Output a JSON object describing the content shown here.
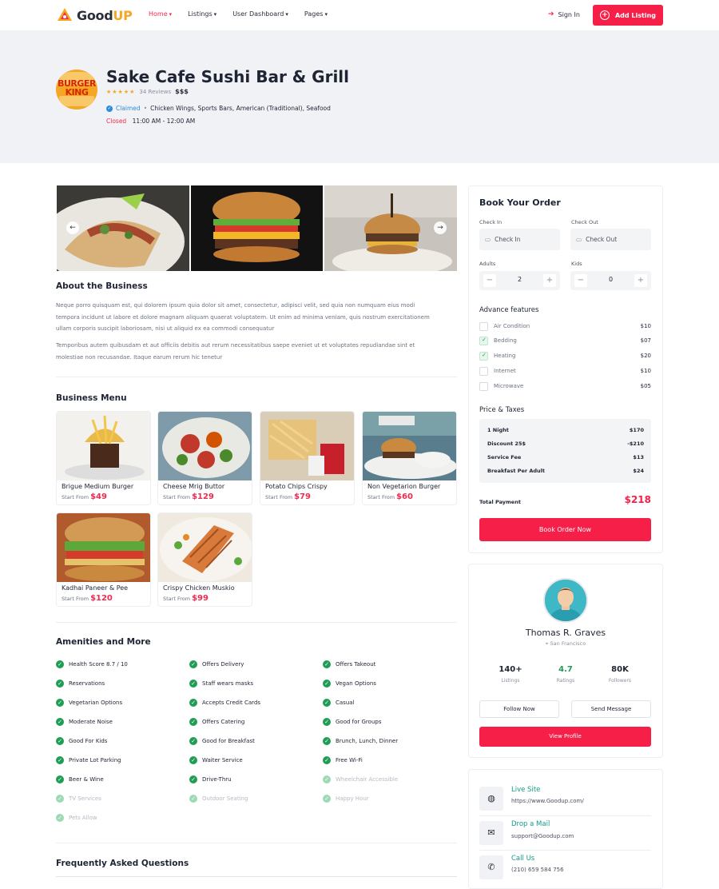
{
  "nav": {
    "brand_good": "Good",
    "brand_up": "UP",
    "menu": [
      "Home",
      "Listings",
      "User Dashboard",
      "Pages"
    ],
    "sign_in": "Sign In",
    "add_listing": "Add Listing"
  },
  "listing": {
    "logo_text": "BURGER KING",
    "title": "Sake Cafe Sushi Bar & Grill",
    "stars": "★★★★★",
    "reviews": "34 Reviews",
    "price_level": "$$$",
    "claimed": "Claimed",
    "categories": "Chicken Wings, Sports Bars, American (Traditional), Seafood",
    "status": "Closed",
    "hours": "11:00 AM - 12:00 AM"
  },
  "about": {
    "title": "About the Business",
    "p1": "Neque porro quisquam est, qui dolorem ipsum quia dolor sit amet, consectetur, adipisci velit, sed quia non numquam eius modi tempora incidunt ut labore et dolore magnam aliquam quaerat voluptatem. Ut enim ad minima veniam, quis nostrum exercitationem ullam corporis suscipit laboriosam, nisi ut aliquid ex ea commodi consequatur",
    "p2": "Temporibus autem quibusdam et aut officiis debitis aut rerum necessitatibus saepe eveniet ut et voluptates repudiandae sint et molestiae non recusandae. Itaque earum rerum hic tenetur"
  },
  "menu": {
    "title": "Business Menu",
    "start_from": "Start From",
    "items": [
      {
        "name": "Brigue Medium Burger",
        "price": "$49"
      },
      {
        "name": "Cheese Mrig Buttor",
        "price": "$129"
      },
      {
        "name": "Potato Chips Crispy",
        "price": "$79"
      },
      {
        "name": "Non Vegetarion Burger",
        "price": "$60"
      },
      {
        "name": "Kadhai Paneer & Pee",
        "price": "$120"
      },
      {
        "name": "Crispy Chicken Muskio",
        "price": "$99"
      }
    ]
  },
  "amenities": {
    "title": "Amenities and More",
    "col1": [
      "Health Score 8.7 / 10",
      "Reservations",
      "Vegetarian Options",
      "Moderate Noise",
      "Good For Kids",
      "Private Lot Parking",
      "Beer & Wine",
      "TV Services",
      "Pets Allow"
    ],
    "col2": [
      "Offers Delivery",
      "Staff wears masks",
      "Accepts Credit Cards",
      "Offers Catering",
      "Good for Breakfast",
      "Waiter Service",
      "Drive-Thru",
      "Outdoor Seating"
    ],
    "col3": [
      "Offers Takeout",
      "Vegan Options",
      "Casual",
      "Good for Groups",
      "Brunch, Lunch, Dinner",
      "Free Wi-Fi",
      "Wheelchair Accessible",
      "Happy Hour"
    ]
  },
  "faq": {
    "title": "Frequently Asked Questions"
  },
  "booking": {
    "title": "Book Your Order",
    "check_in_label": "Check In",
    "check_out_label": "Check Out",
    "check_in_placeholder": "Check In",
    "check_out_placeholder": "Check Out",
    "adults_label": "Adults",
    "kids_label": "Kids",
    "adults": "2",
    "kids": "0",
    "features_title": "Advance features",
    "features": [
      {
        "name": "Air Condition",
        "price": "$10",
        "checked": false
      },
      {
        "name": "Bedding",
        "price": "$07",
        "checked": true
      },
      {
        "name": "Heating",
        "price": "$20",
        "checked": true
      },
      {
        "name": "Internet",
        "price": "$10",
        "checked": false
      },
      {
        "name": "Microwave",
        "price": "$05",
        "checked": false
      }
    ],
    "taxes_title": "Price & Taxes",
    "taxes": [
      {
        "label": "1 Night",
        "value": "$170"
      },
      {
        "label": "Discount 25$",
        "value": "-$210"
      },
      {
        "label": "Service Fee",
        "value": "$13"
      },
      {
        "label": "Breakfast Per Adult",
        "value": "$24"
      }
    ],
    "total_label": "Total Payment",
    "total": "$218",
    "book_button": "Book Order Now"
  },
  "author": {
    "name": "Thomas R. Graves",
    "location": "San Francisco",
    "stats": [
      {
        "value": "140+",
        "label": "Listings"
      },
      {
        "value": "4.7",
        "label": "Ratings"
      },
      {
        "value": "80K",
        "label": "Followers"
      }
    ],
    "follow": "Follow Now",
    "message": "Send Message",
    "view_profile": "View Profile"
  },
  "contact": [
    {
      "title": "Live Site",
      "value": "https://www.Goodup.com/",
      "icon": "globe-icon"
    },
    {
      "title": "Drop a Mail",
      "value": "support@Goodup.com",
      "icon": "mail-icon"
    },
    {
      "title": "Call Us",
      "value": "(210) 659 584 756",
      "icon": "phone-icon"
    }
  ],
  "colors": {
    "accent": "#f51f48",
    "teal": "#139a8a",
    "check": "#1f9d55"
  }
}
